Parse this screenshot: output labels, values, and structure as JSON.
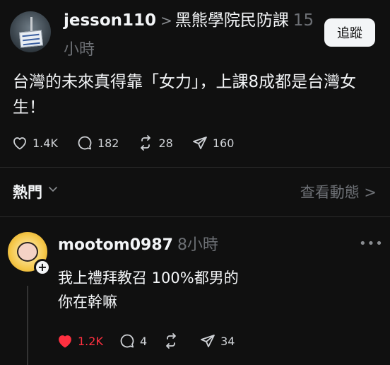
{
  "post": {
    "username": "jesson110",
    "chevron": ">",
    "community": "黑熊學院民防課",
    "time_part1": "15",
    "time_part2": "小時",
    "follow_label": "追蹤",
    "text": "台灣的未來真得靠「女力」，上課8成都是台灣女生！",
    "likes": "1.4K",
    "comments": "182",
    "reposts": "28",
    "shares": "160"
  },
  "sort": {
    "label": "熱門",
    "activity_label": "查看動態",
    "activity_chevron": ">"
  },
  "reply": {
    "username": "mootom0987",
    "time": "8小時",
    "more": "•••",
    "plus": "+",
    "line1": "我上禮拜教召 100%都男的",
    "line2": "你在幹嘛",
    "likes": "1.2K",
    "comments": "4",
    "shares": "34"
  },
  "colors": {
    "background": "#101010",
    "text": "#f3f5f7",
    "muted": "#6d7075",
    "like_red": "#ff3040"
  }
}
